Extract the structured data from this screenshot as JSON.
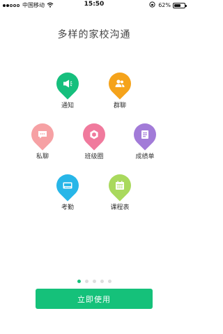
{
  "status_bar": {
    "carrier": "中国移动",
    "time": "15:50",
    "battery": "62%",
    "battery_level": 0.62,
    "signal_bars": 2
  },
  "title": "多样的家校沟通",
  "features": [
    {
      "id": "notice",
      "label": "通知",
      "color": "#16bf7d",
      "icon": "megaphone-icon"
    },
    {
      "id": "group",
      "label": "群聊",
      "color": "#f5a31b",
      "icon": "people-icon"
    },
    {
      "id": "private",
      "label": "私聊",
      "color": "#f6a1a4",
      "icon": "chat-bubble-icon"
    },
    {
      "id": "class-circle",
      "label": "班级圈",
      "color": "#f07a9d",
      "icon": "hexagon-icon"
    },
    {
      "id": "report",
      "label": "成绩单",
      "color": "#a27bd8",
      "icon": "document-icon"
    },
    {
      "id": "attendance",
      "label": "考勤",
      "color": "#27b6e8",
      "icon": "card-reader-icon"
    },
    {
      "id": "schedule",
      "label": "课程表",
      "color": "#a9d95d",
      "icon": "calendar-icon"
    }
  ],
  "pager": {
    "count": 5,
    "active": 0
  },
  "start_button": {
    "label": "立即使用",
    "color": "#15c17a"
  }
}
